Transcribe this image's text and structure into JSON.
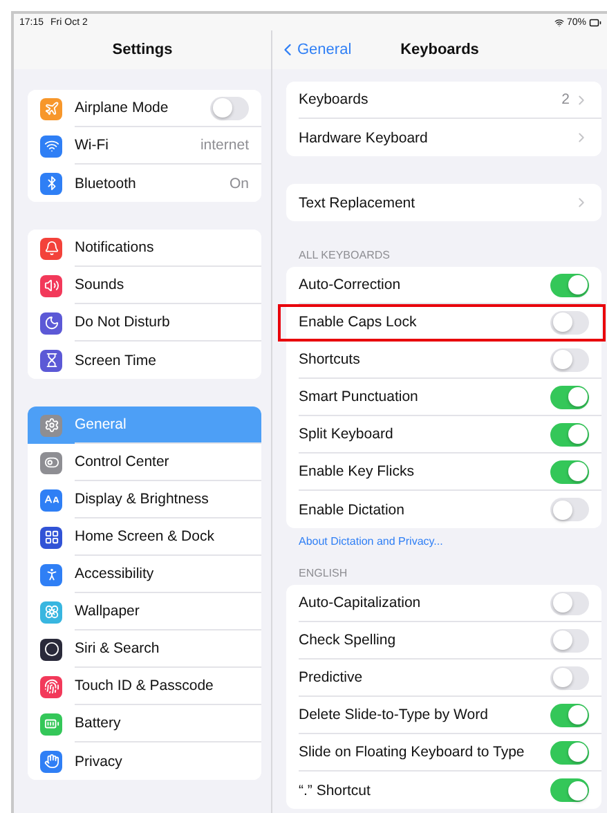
{
  "status_bar": {
    "time": "17:15",
    "date": "Fri Oct 2",
    "battery": "70%"
  },
  "sidebar": {
    "title": "Settings",
    "groups": [
      [
        {
          "label": "Airplane Mode",
          "color": "#f7972b",
          "kind": "toggle",
          "on": false,
          "selected": false
        },
        {
          "label": "Wi-Fi",
          "color": "#2f7ff5",
          "kind": "value",
          "value": "internet",
          "selected": false
        },
        {
          "label": "Bluetooth",
          "color": "#2f7ff5",
          "kind": "value",
          "value": "On",
          "selected": false
        }
      ],
      [
        {
          "label": "Notifications",
          "color": "#f3423a",
          "kind": "nav",
          "selected": false
        },
        {
          "label": "Sounds",
          "color": "#f2395a",
          "kind": "nav",
          "selected": false
        },
        {
          "label": "Do Not Disturb",
          "color": "#5c59d6",
          "kind": "nav",
          "selected": false
        },
        {
          "label": "Screen Time",
          "color": "#5c59d6",
          "kind": "nav",
          "selected": false
        }
      ],
      [
        {
          "label": "General",
          "color": "#8e8e93",
          "kind": "nav",
          "selected": true
        },
        {
          "label": "Control Center",
          "color": "#8e8e93",
          "kind": "nav",
          "selected": false
        },
        {
          "label": "Display & Brightness",
          "color": "#2f7ff5",
          "kind": "nav",
          "selected": false
        },
        {
          "label": "Home Screen & Dock",
          "color": "#3153d6",
          "kind": "nav",
          "selected": false
        },
        {
          "label": "Accessibility",
          "color": "#2f7ff5",
          "kind": "nav",
          "selected": false
        },
        {
          "label": "Wallpaper",
          "color": "#38b6e0",
          "kind": "nav",
          "selected": false
        },
        {
          "label": "Siri & Search",
          "color": "#2a2a3a",
          "kind": "nav",
          "selected": false
        },
        {
          "label": "Touch ID & Passcode",
          "color": "#f2395a",
          "kind": "nav",
          "selected": false
        },
        {
          "label": "Battery",
          "color": "#34c759",
          "kind": "nav",
          "selected": false
        },
        {
          "label": "Privacy",
          "color": "#2f7ff5",
          "kind": "nav",
          "selected": false
        }
      ]
    ]
  },
  "detail": {
    "back": "General",
    "title": "Keyboards",
    "sections": [
      {
        "rows": [
          {
            "label": "Keyboards",
            "kind": "nav",
            "value": "2"
          },
          {
            "label": "Hardware Keyboard",
            "kind": "nav"
          }
        ]
      },
      {
        "rows": [
          {
            "label": "Text Replacement",
            "kind": "nav"
          }
        ]
      },
      {
        "header": "ALL KEYBOARDS",
        "footer_link": "About Dictation and Privacy...",
        "rows": [
          {
            "label": "Auto-Correction",
            "kind": "toggle",
            "on": true,
            "highlighted": false
          },
          {
            "label": "Enable Caps Lock",
            "kind": "toggle",
            "on": false,
            "highlighted": true
          },
          {
            "label": "Shortcuts",
            "kind": "toggle",
            "on": false,
            "highlighted": false
          },
          {
            "label": "Smart Punctuation",
            "kind": "toggle",
            "on": true,
            "highlighted": false
          },
          {
            "label": "Split Keyboard",
            "kind": "toggle",
            "on": true,
            "highlighted": false
          },
          {
            "label": "Enable Key Flicks",
            "kind": "toggle",
            "on": true,
            "highlighted": false
          },
          {
            "label": "Enable Dictation",
            "kind": "toggle",
            "on": false,
            "highlighted": false
          }
        ]
      },
      {
        "header": "ENGLISH",
        "rows": [
          {
            "label": "Auto-Capitalization",
            "kind": "toggle",
            "on": false
          },
          {
            "label": "Check Spelling",
            "kind": "toggle",
            "on": false
          },
          {
            "label": "Predictive",
            "kind": "toggle",
            "on": false
          },
          {
            "label": "Delete Slide-to-Type by Word",
            "kind": "toggle",
            "on": true
          },
          {
            "label": "Slide on Floating Keyboard to Type",
            "kind": "toggle",
            "on": true
          },
          {
            "label": "“.” Shortcut",
            "kind": "toggle",
            "on": true
          }
        ]
      }
    ]
  }
}
